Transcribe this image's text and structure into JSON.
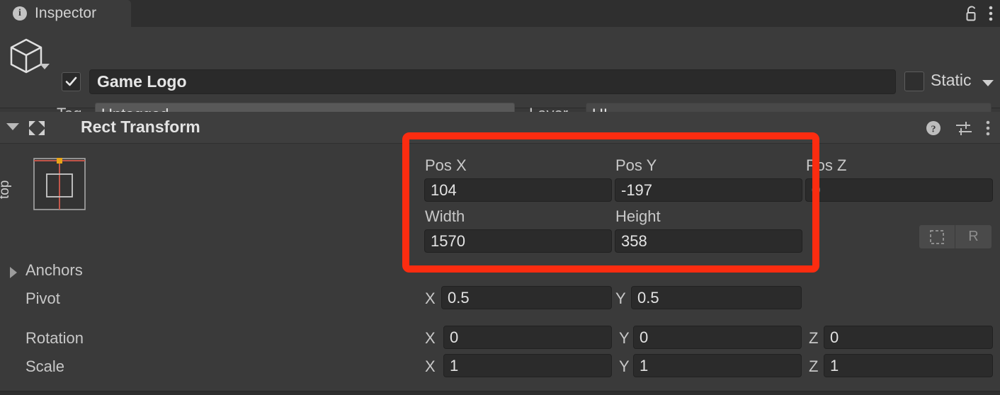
{
  "window": {
    "tab_label": "Inspector",
    "tab_icon": "info-icon",
    "lock_icon": "unlock-padlock-icon",
    "menu_icon": "kebab-menu-icon"
  },
  "gameobject": {
    "icon": "cube-icon",
    "enabled_checkbox": true,
    "name": "Game Logo",
    "static_label": "Static",
    "static_checked": false,
    "tag_label": "Tag",
    "tag_value": "Untagged",
    "layer_label": "Layer",
    "layer_value": "UI"
  },
  "component": {
    "title": "Rect Transform",
    "icon": "rect-transform-icon",
    "expanded": true,
    "help_icon": "help-question-icon",
    "preset_icon": "preset-sliders-icon",
    "menu_icon": "kebab-menu-icon"
  },
  "anchor_preset": {
    "horizontal_label": "center",
    "vertical_label": "top"
  },
  "rect": {
    "pos_x_label": "Pos X",
    "pos_x_value": "104",
    "pos_y_label": "Pos Y",
    "pos_y_value": "-197",
    "pos_z_label": "Pos Z",
    "pos_z_value": "0",
    "width_label": "Width",
    "width_value": "1570",
    "height_label": "Height",
    "height_value": "358",
    "blueprint_button": "",
    "raw_button": "R"
  },
  "anchors": {
    "label": "Anchors",
    "expanded": false
  },
  "pivot": {
    "label": "Pivot",
    "x_axis": "X",
    "x_value": "0.5",
    "y_axis": "Y",
    "y_value": "0.5"
  },
  "rotation": {
    "label": "Rotation",
    "x_axis": "X",
    "x_value": "0",
    "y_axis": "Y",
    "y_value": "0",
    "z_axis": "Z",
    "z_value": "0"
  },
  "scale": {
    "label": "Scale",
    "x_axis": "X",
    "x_value": "1",
    "y_axis": "Y",
    "y_value": "1",
    "z_axis": "Z",
    "z_value": "1"
  },
  "annotation": {
    "highlight_color": "#fb2c10",
    "shape": "rounded-rectangle"
  }
}
